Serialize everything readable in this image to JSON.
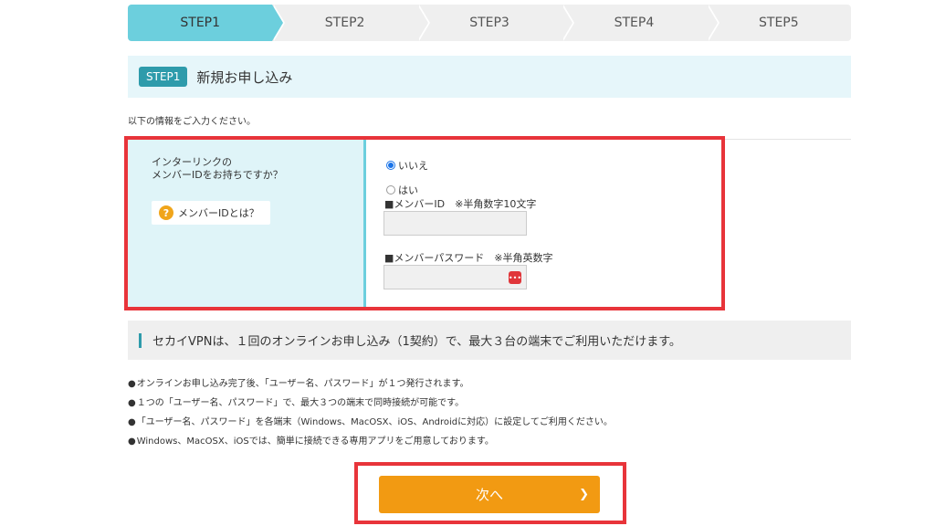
{
  "steps": [
    {
      "label": "STEP1",
      "active": true
    },
    {
      "label": "STEP2",
      "active": false
    },
    {
      "label": "STEP3",
      "active": false
    },
    {
      "label": "STEP4",
      "active": false
    },
    {
      "label": "STEP5",
      "active": false
    }
  ],
  "section": {
    "badge": "STEP1",
    "title": "新規お申し込み"
  },
  "intro": "以下の情報をご入力ください。",
  "question": {
    "text_line1": "インターリンクの",
    "text_line2": "メンバーIDをお持ちですか？",
    "help_icon": "?",
    "help_label": "メンバーIDとは？"
  },
  "options": {
    "no": "いいえ",
    "yes": "はい",
    "selected": "いいえ"
  },
  "member_id": {
    "label": "■メンバーID　※半角数字10文字",
    "value": ""
  },
  "member_password": {
    "label": "■メンバーパスワード　※半角英数字",
    "value": "",
    "icon": "password-manager-icon"
  },
  "info": {
    "banner": "セカイVPNは、１回のオンラインお申し込み（1契約）で、最大３台の端末でご利用いただけます。",
    "notes": [
      "オンラインお申し込み完了後、「ユーザー名、パスワード」が１つ発行されます。",
      "１つの「ユーザー名、パスワード」で、最大３つの端末で同時接続が可能です。",
      "「ユーザー名、パスワード」を各端末（Windows、MacOSX、iOS、Androidに対応）に設定してご利用ください。",
      "Windows、MacOSX、iOSでは、簡単に接続できる専用アプリをご用意しております。"
    ]
  },
  "next_button": {
    "label": "次へ",
    "chevron": "❯"
  },
  "colors": {
    "step_active": "#6ccfdd",
    "step_inactive": "#efefef",
    "badge": "#2e9bab",
    "highlight_border": "#e8343a",
    "next_button": "#f29a12"
  }
}
